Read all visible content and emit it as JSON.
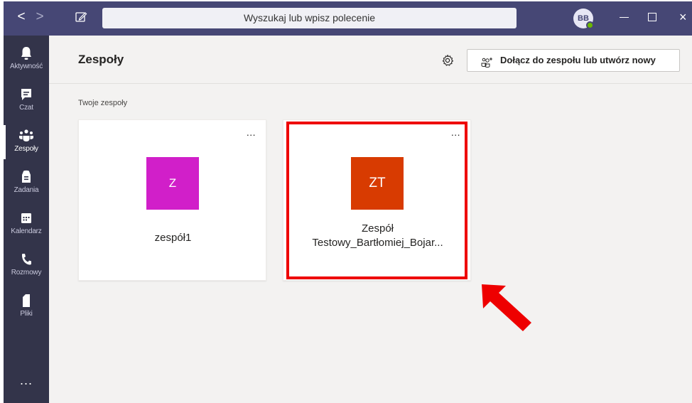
{
  "titlebar": {
    "back_glyph": "<",
    "forward_glyph": ">",
    "search_placeholder": "Wyszukaj lub wpisz polecenie",
    "avatar_initials": "BB",
    "close_glyph": "×"
  },
  "rail": {
    "items": [
      {
        "label": "Aktywność",
        "icon": "bell-icon"
      },
      {
        "label": "Czat",
        "icon": "chat-icon"
      },
      {
        "label": "Zespoły",
        "icon": "teams-icon",
        "active": true
      },
      {
        "label": "Zadania",
        "icon": "assignments-icon"
      },
      {
        "label": "Kalendarz",
        "icon": "calendar-icon"
      },
      {
        "label": "Rozmowy",
        "icon": "phone-icon"
      },
      {
        "label": "Pliki",
        "icon": "file-icon"
      }
    ],
    "more": "..."
  },
  "header": {
    "title": "Zespoły",
    "join_button": "Dołącz do zespołu lub utwórz nowy"
  },
  "section_label": "Twoje zespoły",
  "teams": [
    {
      "initials": "Z",
      "name": "zespół1",
      "color": "#d11fc9",
      "more": "..."
    },
    {
      "initials": "ZT",
      "name_line1": "Zespół",
      "name_line2": "Testowy_Bartłomiej_Bojar...",
      "color": "#d83b01",
      "more": "..."
    }
  ],
  "colors": {
    "titlebar": "#464775",
    "rail": "#33344a",
    "highlight": "#ee0000",
    "arrow": "#ee0000"
  }
}
